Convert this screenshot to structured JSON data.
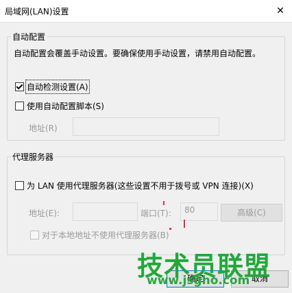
{
  "window": {
    "title": "局域网(LAN)设置",
    "close_icon": "✕"
  },
  "auto_config": {
    "group_label": "自动配置",
    "description": "自动配置会覆盖手动设置。要确保使用手动设置，请禁用自动配置。",
    "auto_detect_label": "自动检测设置(A)",
    "auto_detect_checked": true,
    "use_script_label": "使用自动配置脚本(S)",
    "use_script_checked": false,
    "address_label": "地址(R)",
    "address_value": ""
  },
  "proxy": {
    "group_label": "代理服务器",
    "use_proxy_label": "为 LAN 使用代理服务器(这些设置不用于拨号或 VPN 连接)(X)",
    "use_proxy_checked": false,
    "address_label": "地址(E):",
    "address_value": "",
    "port_label": "端口(T):",
    "port_value": "80",
    "advanced_label": "高级(C)",
    "bypass_local_label": "对于本地地址不使用代理服务器(B)",
    "bypass_local_checked": false
  },
  "buttons": {
    "ok_label": "确定",
    "cancel_label": "取消"
  },
  "watermark": {
    "text": "技术员联盟",
    "url": "www.jsgho.com"
  },
  "colors": {
    "watermark_green": "#21a83a",
    "accent_red": "#e0343b"
  }
}
